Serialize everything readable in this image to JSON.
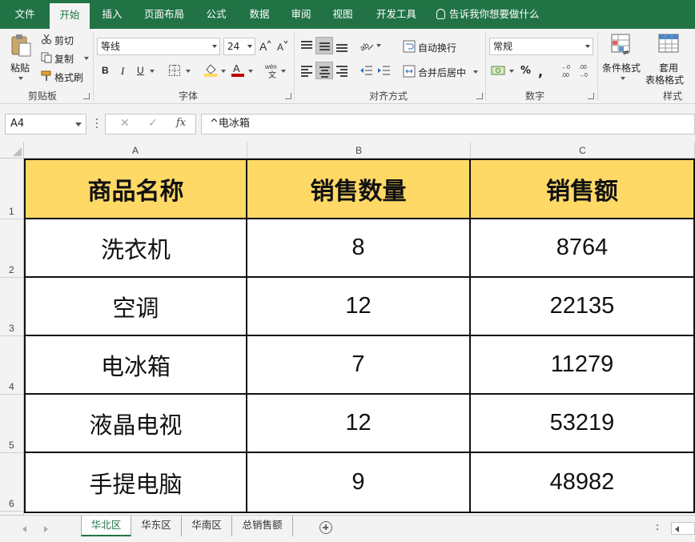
{
  "ribbon_tabs": [
    "文件",
    "开始",
    "插入",
    "页面布局",
    "公式",
    "数据",
    "审阅",
    "视图",
    "开发工具"
  ],
  "active_tab": "开始",
  "tell_me": "告诉我你想要做什么",
  "clipboard": {
    "paste": "粘贴",
    "cut": "剪切",
    "copy": "复制",
    "format_painter": "格式刷",
    "group_label": "剪贴板"
  },
  "font": {
    "name": "等线",
    "size": "24",
    "bold": "B",
    "italic": "I",
    "underline": "U",
    "group_label": "字体",
    "fill_color": "#ffd966",
    "font_color": "#c00000"
  },
  "alignment": {
    "wrap_text": "自动换行",
    "merge_center": "合并后居中",
    "group_label": "对齐方式"
  },
  "number": {
    "format": "常规",
    "group_label": "数字"
  },
  "styles": {
    "conditional_format": "条件格式",
    "table_format_line1": "套用",
    "table_format_line2": "表格格式",
    "group_label": "样式"
  },
  "formula_bar": {
    "name_box": "A4",
    "fx": "fx",
    "content": "^电冰箱"
  },
  "grid": {
    "columns": [
      "A",
      "B",
      "C"
    ],
    "row_numbers": [
      "1",
      "2",
      "3",
      "4",
      "5",
      "6"
    ],
    "header": [
      "商品名称",
      "销售数量",
      "销售额"
    ],
    "rows": [
      [
        "洗衣机",
        "8",
        "8764"
      ],
      [
        "空调",
        "12",
        "22135"
      ],
      [
        "电冰箱",
        "7",
        "11279"
      ],
      [
        "液晶电视",
        "12",
        "53219"
      ],
      [
        "手提电脑",
        "9",
        "48982"
      ]
    ],
    "header_fill": "#ffd966"
  },
  "sheets": [
    "华北区",
    "华东区",
    "华南区",
    "总销售额"
  ],
  "active_sheet": "华北区",
  "colors": {
    "excel_green": "#217346",
    "ribbon_bg": "#f3f3f3"
  }
}
